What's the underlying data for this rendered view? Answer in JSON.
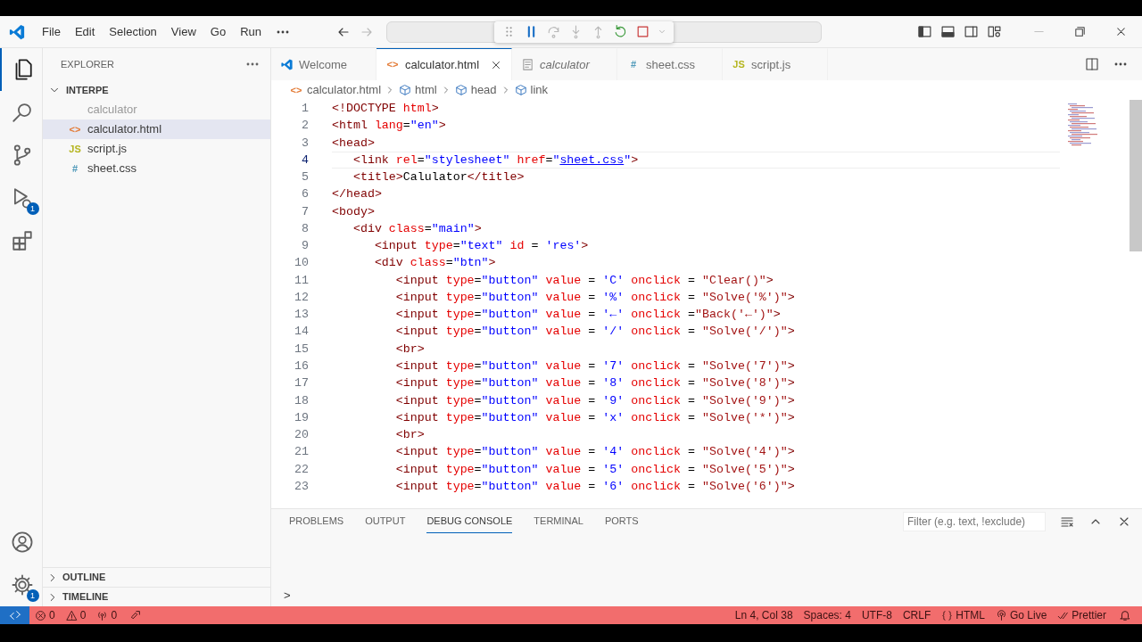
{
  "title_bar": {
    "menu": [
      "File",
      "Edit",
      "Selection",
      "View",
      "Go",
      "Run"
    ]
  },
  "activity_bar": {
    "top": [
      {
        "kind": "explorer",
        "selected": true
      },
      {
        "kind": "search",
        "selected": false
      },
      {
        "kind": "source-control",
        "selected": false
      },
      {
        "kind": "debug",
        "selected": false,
        "badge": "1"
      },
      {
        "kind": "extensions",
        "selected": false
      }
    ],
    "bottom": [
      {
        "kind": "account",
        "selected": false
      },
      {
        "kind": "settings",
        "selected": false,
        "badge": "1"
      }
    ]
  },
  "sidebar": {
    "title": "EXPLORER",
    "folder": {
      "name": "INTERPE",
      "expanded": true,
      "files": [
        {
          "name": "calculator",
          "selected": false,
          "dimmed": true
        },
        {
          "name": "calculator.html",
          "kind": "html",
          "icon": "<>",
          "selected": true,
          "dimmed": false
        },
        {
          "name": "script.js",
          "kind": "js",
          "icon": "JS",
          "selected": false,
          "dimmed": false
        },
        {
          "name": "sheet.css",
          "kind": "css",
          "icon": "#",
          "selected": false,
          "dimmed": false
        }
      ]
    },
    "sections": [
      {
        "label": "OUTLINE",
        "expanded": false
      },
      {
        "label": "TIMELINE",
        "expanded": false
      }
    ]
  },
  "tabs": [
    {
      "label": "Welcome",
      "kind": "welcome",
      "selected": false,
      "preview": false
    },
    {
      "label": "calculator.html",
      "kind": "html",
      "icon": "<>",
      "selected": true,
      "preview": false
    },
    {
      "label": "calculator",
      "kind": "preview",
      "selected": false,
      "preview": true
    },
    {
      "label": "sheet.css",
      "kind": "css",
      "icon": "#",
      "selected": false,
      "preview": false
    },
    {
      "label": "script.js",
      "kind": "js",
      "icon": "JS",
      "selected": false,
      "preview": false
    }
  ],
  "breadcrumbs": [
    {
      "label": "calculator.html",
      "kind": "file",
      "icon": "<>"
    },
    {
      "label": "html",
      "kind": "element"
    },
    {
      "label": "head",
      "kind": "element"
    },
    {
      "label": "link",
      "kind": "element"
    }
  ],
  "editor": {
    "lines": [
      {
        "number": "1",
        "current": false,
        "tokens": [
          {
            "kind": "tag",
            "text": "<!DOCTYPE"
          },
          {
            "kind": "attr",
            "text": " html"
          },
          {
            "kind": "tag",
            "text": ">"
          }
        ]
      },
      {
        "number": "2",
        "current": false,
        "tokens": [
          {
            "kind": "tag",
            "text": "<html"
          },
          {
            "kind": "attr",
            "text": " lang"
          },
          {
            "kind": "plain",
            "text": "="
          },
          {
            "kind": "string",
            "text": "\"en\""
          },
          {
            "kind": "tag",
            "text": ">"
          }
        ]
      },
      {
        "number": "3",
        "current": false,
        "tokens": [
          {
            "kind": "tag",
            "text": "<head>"
          }
        ]
      },
      {
        "number": "4",
        "current": true,
        "tokens": [
          {
            "kind": "tag",
            "text": "   <link"
          },
          {
            "kind": "attr",
            "text": " rel"
          },
          {
            "kind": "plain",
            "text": "="
          },
          {
            "kind": "string",
            "text": "\"stylesheet\""
          },
          {
            "kind": "attr",
            "text": " href"
          },
          {
            "kind": "plain",
            "text": "="
          },
          {
            "kind": "string",
            "text": "\""
          },
          {
            "kind": "link",
            "text": "sheet.css"
          },
          {
            "kind": "string",
            "text": "\""
          },
          {
            "kind": "tag",
            "text": ">"
          }
        ]
      },
      {
        "number": "5",
        "current": false,
        "tokens": [
          {
            "kind": "tag",
            "text": "   <title>"
          },
          {
            "kind": "text",
            "text": "Calulator"
          },
          {
            "kind": "tag",
            "text": "</title>"
          }
        ]
      },
      {
        "number": "6",
        "current": false,
        "tokens": [
          {
            "kind": "tag",
            "text": "</head>"
          }
        ]
      },
      {
        "number": "7",
        "current": false,
        "tokens": [
          {
            "kind": "tag",
            "text": "<body>"
          }
        ]
      },
      {
        "number": "8",
        "current": false,
        "tokens": [
          {
            "kind": "tag",
            "text": "   <div"
          },
          {
            "kind": "attr",
            "text": " class"
          },
          {
            "kind": "plain",
            "text": "="
          },
          {
            "kind": "string",
            "text": "\"main\""
          },
          {
            "kind": "tag",
            "text": ">"
          }
        ]
      },
      {
        "number": "9",
        "current": false,
        "tokens": [
          {
            "kind": "tag",
            "text": "      <input"
          },
          {
            "kind": "attr",
            "text": " type"
          },
          {
            "kind": "plain",
            "text": "="
          },
          {
            "kind": "string",
            "text": "\"text\""
          },
          {
            "kind": "attr",
            "text": " id"
          },
          {
            "kind": "plain",
            "text": " = "
          },
          {
            "kind": "string",
            "text": "'res'"
          },
          {
            "kind": "tag",
            "text": ">"
          }
        ]
      },
      {
        "number": "10",
        "current": false,
        "tokens": [
          {
            "kind": "tag",
            "text": "      <div"
          },
          {
            "kind": "attr",
            "text": " class"
          },
          {
            "kind": "plain",
            "text": "="
          },
          {
            "kind": "string",
            "text": "\"btn\""
          },
          {
            "kind": "tag",
            "text": ">"
          }
        ]
      },
      {
        "number": "11",
        "current": false,
        "tokens": [
          {
            "kind": "tag",
            "text": "         <input"
          },
          {
            "kind": "attr",
            "text": " type"
          },
          {
            "kind": "plain",
            "text": "="
          },
          {
            "kind": "string",
            "text": "\"button\""
          },
          {
            "kind": "attr",
            "text": " value"
          },
          {
            "kind": "plain",
            "text": " = "
          },
          {
            "kind": "string",
            "text": "'C'"
          },
          {
            "kind": "attr",
            "text": " onclick"
          },
          {
            "kind": "plain",
            "text": " = "
          },
          {
            "kind": "js",
            "text": "\"Clear()\""
          },
          {
            "kind": "tag",
            "text": ">"
          }
        ]
      },
      {
        "number": "12",
        "current": false,
        "tokens": [
          {
            "kind": "tag",
            "text": "         <input"
          },
          {
            "kind": "attr",
            "text": " type"
          },
          {
            "kind": "plain",
            "text": "="
          },
          {
            "kind": "string",
            "text": "\"button\""
          },
          {
            "kind": "attr",
            "text": " value"
          },
          {
            "kind": "plain",
            "text": " = "
          },
          {
            "kind": "string",
            "text": "'%'"
          },
          {
            "kind": "attr",
            "text": " onclick"
          },
          {
            "kind": "plain",
            "text": " = "
          },
          {
            "kind": "js",
            "text": "\"Solve('%')\""
          },
          {
            "kind": "tag",
            "text": ">"
          }
        ]
      },
      {
        "number": "13",
        "current": false,
        "tokens": [
          {
            "kind": "tag",
            "text": "         <input"
          },
          {
            "kind": "attr",
            "text": " type"
          },
          {
            "kind": "plain",
            "text": "="
          },
          {
            "kind": "string",
            "text": "\"button\""
          },
          {
            "kind": "attr",
            "text": " value"
          },
          {
            "kind": "plain",
            "text": " = "
          },
          {
            "kind": "string",
            "text": "'←'"
          },
          {
            "kind": "attr",
            "text": " onclick"
          },
          {
            "kind": "plain",
            "text": " ="
          },
          {
            "kind": "js",
            "text": "\"Back('←')\""
          },
          {
            "kind": "tag",
            "text": ">"
          }
        ]
      },
      {
        "number": "14",
        "current": false,
        "tokens": [
          {
            "kind": "tag",
            "text": "         <input"
          },
          {
            "kind": "attr",
            "text": " type"
          },
          {
            "kind": "plain",
            "text": "="
          },
          {
            "kind": "string",
            "text": "\"button\""
          },
          {
            "kind": "attr",
            "text": " value"
          },
          {
            "kind": "plain",
            "text": " = "
          },
          {
            "kind": "string",
            "text": "'/'"
          },
          {
            "kind": "attr",
            "text": " onclick"
          },
          {
            "kind": "plain",
            "text": " = "
          },
          {
            "kind": "js",
            "text": "\"Solve('/')\""
          },
          {
            "kind": "tag",
            "text": ">"
          }
        ]
      },
      {
        "number": "15",
        "current": false,
        "tokens": [
          {
            "kind": "tag",
            "text": "         <br>"
          }
        ]
      },
      {
        "number": "16",
        "current": false,
        "tokens": [
          {
            "kind": "tag",
            "text": "         <input"
          },
          {
            "kind": "attr",
            "text": " type"
          },
          {
            "kind": "plain",
            "text": "="
          },
          {
            "kind": "string",
            "text": "\"button\""
          },
          {
            "kind": "attr",
            "text": " value"
          },
          {
            "kind": "plain",
            "text": " = "
          },
          {
            "kind": "string",
            "text": "'7'"
          },
          {
            "kind": "attr",
            "text": " onclick"
          },
          {
            "kind": "plain",
            "text": " = "
          },
          {
            "kind": "js",
            "text": "\"Solve('7')\""
          },
          {
            "kind": "tag",
            "text": ">"
          }
        ]
      },
      {
        "number": "17",
        "current": false,
        "tokens": [
          {
            "kind": "tag",
            "text": "         <input"
          },
          {
            "kind": "attr",
            "text": " type"
          },
          {
            "kind": "plain",
            "text": "="
          },
          {
            "kind": "string",
            "text": "\"button\""
          },
          {
            "kind": "attr",
            "text": " value"
          },
          {
            "kind": "plain",
            "text": " = "
          },
          {
            "kind": "string",
            "text": "'8'"
          },
          {
            "kind": "attr",
            "text": " onclick"
          },
          {
            "kind": "plain",
            "text": " = "
          },
          {
            "kind": "js",
            "text": "\"Solve('8')\""
          },
          {
            "kind": "tag",
            "text": ">"
          }
        ]
      },
      {
        "number": "18",
        "current": false,
        "tokens": [
          {
            "kind": "tag",
            "text": "         <input"
          },
          {
            "kind": "attr",
            "text": " type"
          },
          {
            "kind": "plain",
            "text": "="
          },
          {
            "kind": "string",
            "text": "\"button\""
          },
          {
            "kind": "attr",
            "text": " value"
          },
          {
            "kind": "plain",
            "text": " = "
          },
          {
            "kind": "string",
            "text": "'9'"
          },
          {
            "kind": "attr",
            "text": " onclick"
          },
          {
            "kind": "plain",
            "text": " = "
          },
          {
            "kind": "js",
            "text": "\"Solve('9')\""
          },
          {
            "kind": "tag",
            "text": ">"
          }
        ]
      },
      {
        "number": "19",
        "current": false,
        "tokens": [
          {
            "kind": "tag",
            "text": "         <input"
          },
          {
            "kind": "attr",
            "text": " type"
          },
          {
            "kind": "plain",
            "text": "="
          },
          {
            "kind": "string",
            "text": "\"button\""
          },
          {
            "kind": "attr",
            "text": " value"
          },
          {
            "kind": "plain",
            "text": " = "
          },
          {
            "kind": "string",
            "text": "'x'"
          },
          {
            "kind": "attr",
            "text": " onclick"
          },
          {
            "kind": "plain",
            "text": " = "
          },
          {
            "kind": "js",
            "text": "\"Solve('*')\""
          },
          {
            "kind": "tag",
            "text": ">"
          }
        ]
      },
      {
        "number": "20",
        "current": false,
        "tokens": [
          {
            "kind": "tag",
            "text": "         <br>"
          }
        ]
      },
      {
        "number": "21",
        "current": false,
        "tokens": [
          {
            "kind": "tag",
            "text": "         <input"
          },
          {
            "kind": "attr",
            "text": " type"
          },
          {
            "kind": "plain",
            "text": "="
          },
          {
            "kind": "string",
            "text": "\"button\""
          },
          {
            "kind": "attr",
            "text": " value"
          },
          {
            "kind": "plain",
            "text": " = "
          },
          {
            "kind": "string",
            "text": "'4'"
          },
          {
            "kind": "attr",
            "text": " onclick"
          },
          {
            "kind": "plain",
            "text": " = "
          },
          {
            "kind": "js",
            "text": "\"Solve('4')\""
          },
          {
            "kind": "tag",
            "text": ">"
          }
        ]
      },
      {
        "number": "22",
        "current": false,
        "tokens": [
          {
            "kind": "tag",
            "text": "         <input"
          },
          {
            "kind": "attr",
            "text": " type"
          },
          {
            "kind": "plain",
            "text": "="
          },
          {
            "kind": "string",
            "text": "\"button\""
          },
          {
            "kind": "attr",
            "text": " value"
          },
          {
            "kind": "plain",
            "text": " = "
          },
          {
            "kind": "string",
            "text": "'5'"
          },
          {
            "kind": "attr",
            "text": " onclick"
          },
          {
            "kind": "plain",
            "text": " = "
          },
          {
            "kind": "js",
            "text": "\"Solve('5')\""
          },
          {
            "kind": "tag",
            "text": ">"
          }
        ]
      },
      {
        "number": "23",
        "current": false,
        "tokens": [
          {
            "kind": "tag",
            "text": "         <input"
          },
          {
            "kind": "attr",
            "text": " type"
          },
          {
            "kind": "plain",
            "text": "="
          },
          {
            "kind": "string",
            "text": "\"button\""
          },
          {
            "kind": "attr",
            "text": " value"
          },
          {
            "kind": "plain",
            "text": " = "
          },
          {
            "kind": "string",
            "text": "'6'"
          },
          {
            "kind": "attr",
            "text": " onclick"
          },
          {
            "kind": "plain",
            "text": " = "
          },
          {
            "kind": "js",
            "text": "\"Solve('6')\""
          },
          {
            "kind": "tag",
            "text": ">"
          }
        ]
      }
    ]
  },
  "panel": {
    "tabs": [
      {
        "label": "PROBLEMS",
        "selected": false
      },
      {
        "label": "OUTPUT",
        "selected": false
      },
      {
        "label": "DEBUG CONSOLE",
        "selected": true
      },
      {
        "label": "TERMINAL",
        "selected": false
      },
      {
        "label": "PORTS",
        "selected": false
      }
    ],
    "filter": {
      "placeholder": "Filter (e.g. text, !exclude)"
    },
    "prompt": ">"
  },
  "status_bar": {
    "left": [
      {
        "kind": "errors",
        "text": "0"
      },
      {
        "kind": "warnings",
        "text": "0"
      },
      {
        "kind": "ports",
        "text": "0"
      },
      {
        "kind": "launch"
      }
    ],
    "right": [
      {
        "kind": "text",
        "text": "Ln 4, Col 38"
      },
      {
        "kind": "text",
        "text": "Spaces: 4"
      },
      {
        "kind": "text",
        "text": "UTF-8"
      },
      {
        "kind": "text",
        "text": "CRLF"
      },
      {
        "kind": "language",
        "text": "HTML"
      },
      {
        "kind": "live",
        "text": "Go Live"
      },
      {
        "kind": "prettier",
        "text": "Prettier"
      },
      {
        "kind": "bell"
      }
    ]
  }
}
